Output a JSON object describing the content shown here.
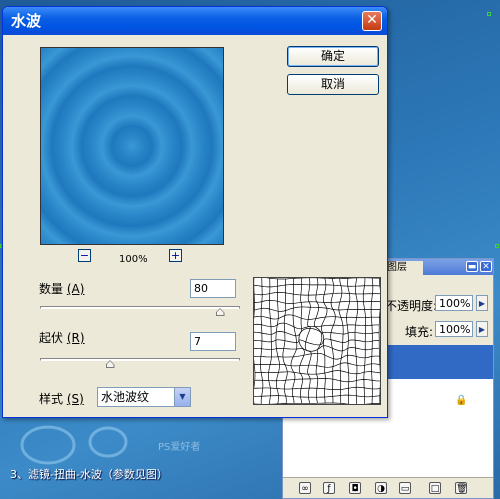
{
  "dialog": {
    "title": "水波",
    "close_glyph": "✕",
    "ok_label": "确定",
    "cancel_label": "取消",
    "zoom": {
      "out_glyph": "−",
      "in_glyph": "+",
      "value": "100%"
    },
    "amount": {
      "label": "数量",
      "key": "(A)",
      "value": "80",
      "slider_fraction": 0.9
    },
    "ridges": {
      "label": "起伏",
      "key": "(R)",
      "value": "7",
      "slider_fraction": 0.35
    },
    "style": {
      "label": "样式",
      "key": "(S)",
      "selected": "水池波纹"
    }
  },
  "layers_panel": {
    "tab_label": "图层",
    "opacity_label": "不透明度:",
    "opacity_value": "100%",
    "fill_label": "填充:",
    "fill_value": "100%"
  },
  "caption": "3、滤镜-扭曲-水波（参数见图）",
  "watermark": "PS爱好者"
}
